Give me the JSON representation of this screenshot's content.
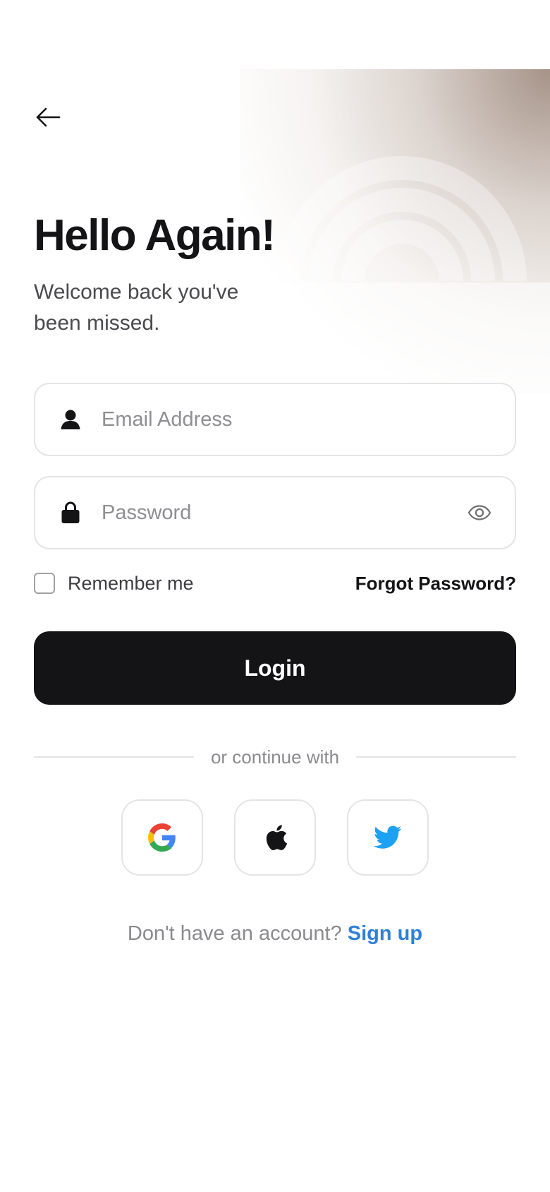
{
  "header": {
    "back_icon": "arrow-left-icon"
  },
  "intro": {
    "title": "Hello Again!",
    "subtitle": "Welcome back you've been missed."
  },
  "form": {
    "email": {
      "placeholder": "Email Address",
      "value": "",
      "icon": "user-icon"
    },
    "password": {
      "placeholder": "Password",
      "value": "",
      "icon": "lock-icon",
      "toggle_icon": "eye-icon"
    },
    "remember_label": "Remember me",
    "remember_checked": false,
    "forgot_label": "Forgot Password?",
    "login_label": "Login"
  },
  "social": {
    "divider_text": "or continue with",
    "providers": [
      {
        "name": "Google",
        "icon": "google-icon"
      },
      {
        "name": "Apple",
        "icon": "apple-icon"
      },
      {
        "name": "Twitter",
        "icon": "twitter-icon"
      }
    ]
  },
  "footer": {
    "prompt": "Don't have an account?",
    "signup_label": "Sign up"
  },
  "colors": {
    "primary": "#141416",
    "link": "#2f80d8",
    "border": "#e4e4e7",
    "muted_text": "#8a8a8f",
    "twitter": "#1da1f2"
  }
}
